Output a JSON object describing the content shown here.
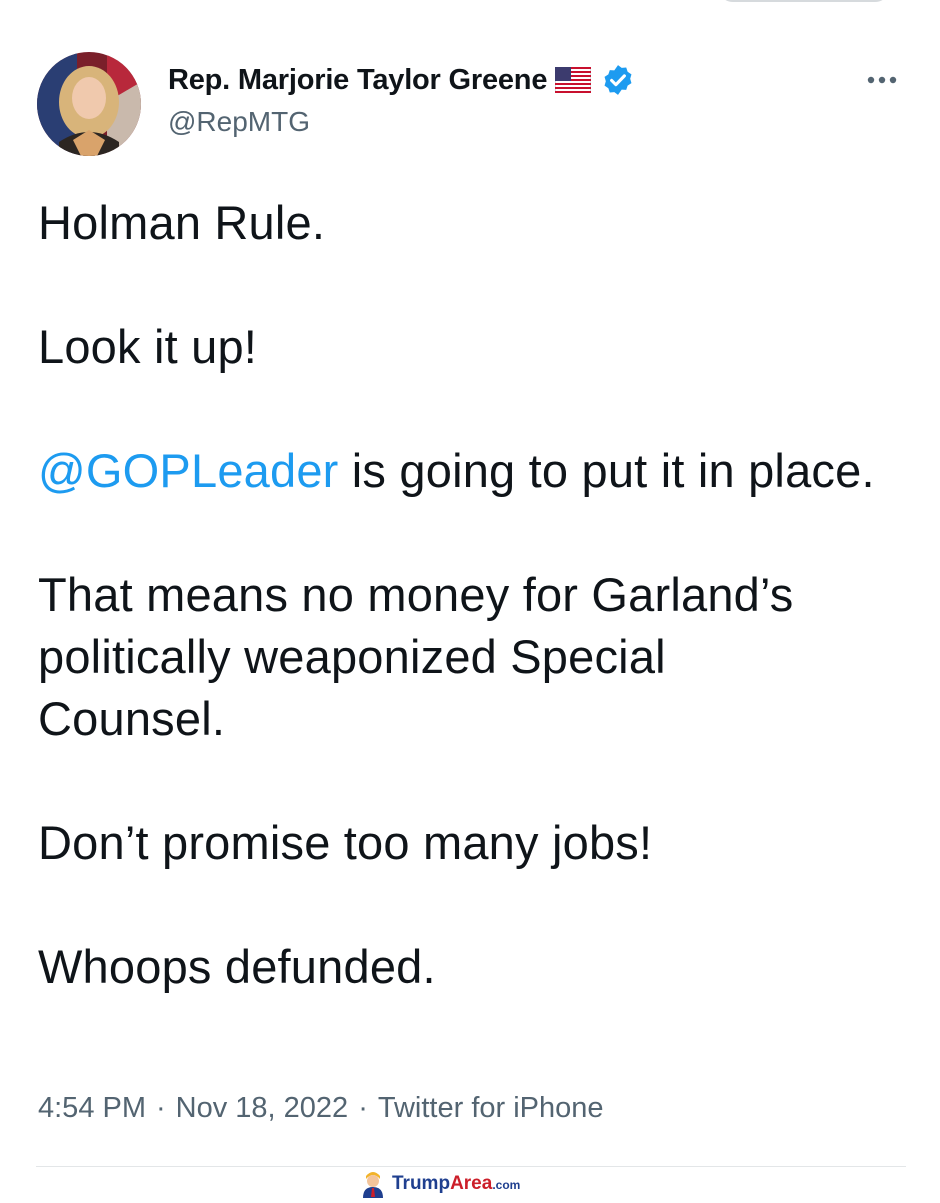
{
  "author": {
    "display_name": "Rep. Marjorie Taylor Greene",
    "handle": "@RepMTG",
    "flag_icon": "us-flag-icon",
    "verified_icon": "verified-badge-icon",
    "verified_color": "#1d9bf0"
  },
  "tweet": {
    "line1": "Holman Rule.",
    "line2": "Look it up!",
    "mention": "@GOPLeader",
    "line3_rest": " is going to put it in place.",
    "line4": "That means no money for Garland’s politically weaponized Special Counsel.",
    "line5": "Don’t promise too many jobs!",
    "line6": "Whoops defunded."
  },
  "meta": {
    "time": "4:54 PM",
    "sep1": "·",
    "date": "Nov 18, 2022",
    "sep2": "·",
    "source": "Twitter for iPhone"
  },
  "watermark": {
    "brand_part1": "Trump",
    "brand_part2": "Area",
    "brand_suffix": ".com"
  },
  "colors": {
    "link": "#1d9bf0",
    "secondary_text": "#536471",
    "text": "#0f1419"
  }
}
